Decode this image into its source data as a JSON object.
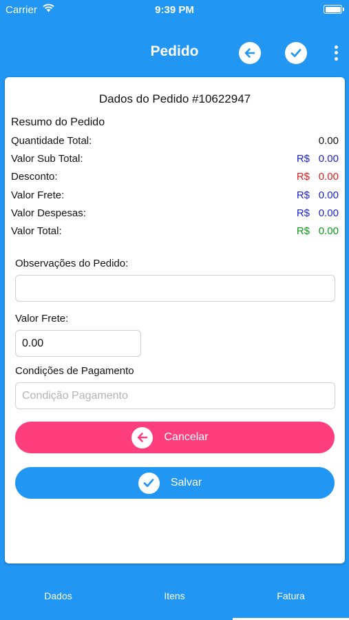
{
  "status_bar": {
    "carrier": "Carrier",
    "time": "9:39 PM"
  },
  "nav": {
    "title": "Pedido",
    "back_icon": "arrow-left-icon",
    "confirm_icon": "check-icon",
    "menu_icon": "more-vertical-icon"
  },
  "order": {
    "title": "Dados do Pedido #10622947",
    "summary_title": "Resumo do Pedido",
    "rows": [
      {
        "label": "Quantidade Total:",
        "currency": "",
        "value": "0.00"
      },
      {
        "label": "Valor Sub Total:",
        "currency": "R$",
        "value": "0.00"
      },
      {
        "label": "Desconto:",
        "currency": "R$",
        "value": "0.00"
      },
      {
        "label": "Valor Frete:",
        "currency": "R$",
        "value": "0.00"
      },
      {
        "label": "Valor Despesas:",
        "currency": "R$",
        "value": "0.00"
      },
      {
        "label": "Valor Total:",
        "currency": "R$",
        "value": "0.00"
      }
    ]
  },
  "form": {
    "notes_label": "Observações do Pedido:",
    "notes_value": "",
    "freight_label": "Valor Frete:",
    "freight_value": "0.00",
    "payment_label": "Condições de Pagamento",
    "payment_placeholder": "Condição Pagamento"
  },
  "buttons": {
    "cancel": "Cancelar",
    "save": "Salvar"
  },
  "colors": {
    "primary": "#2196f3",
    "cancel": "#ff3f7d",
    "positive": "#0a9a18",
    "negative": "#e11b1b",
    "neutral_value": "#1a22d6"
  },
  "tabs": [
    "Dados",
    "Itens",
    "Fatura"
  ],
  "active_tab": "Fatura"
}
